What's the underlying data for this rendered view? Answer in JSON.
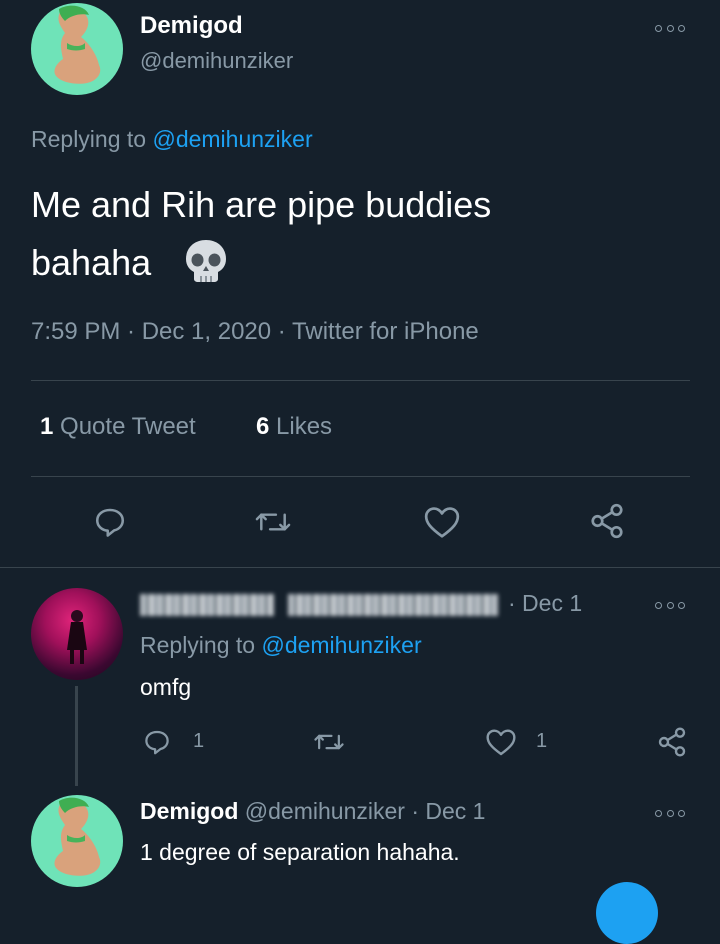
{
  "main_tweet": {
    "author_name": "Demigod",
    "author_handle": "@demihunziker",
    "replying_prefix": "Replying to",
    "replying_handle": "@demihunziker",
    "text_line1": "Me and Rih are pipe buddies",
    "text_line2": "bahaha",
    "emoji": "skull",
    "timestamp": "7:59 PM · Dec 1, 2020 · Twitter for iPhone",
    "quote_count": "1",
    "quote_label": "Quote Tweet",
    "like_count": "6",
    "like_label": "Likes"
  },
  "reply_1": {
    "date": "· Dec 1",
    "replying_prefix": "Replying to",
    "replying_handle": "@demihunziker",
    "text": "omfg",
    "reply_count": "1",
    "like_count": "1"
  },
  "reply_2": {
    "author_name": "Demigod",
    "author_handle": "@demihunziker",
    "date": "· Dec 1",
    "text": "1 degree of separation hahaha."
  },
  "icons": [
    "reply-icon",
    "retweet-icon",
    "like-icon",
    "share-icon",
    "more-icon",
    "skull-icon"
  ],
  "colors": {
    "background": "#15202b",
    "muted": "#8899a6",
    "link": "#1da1f2",
    "divider": "#38444d",
    "avatar_bg": "#6fe3b8"
  }
}
